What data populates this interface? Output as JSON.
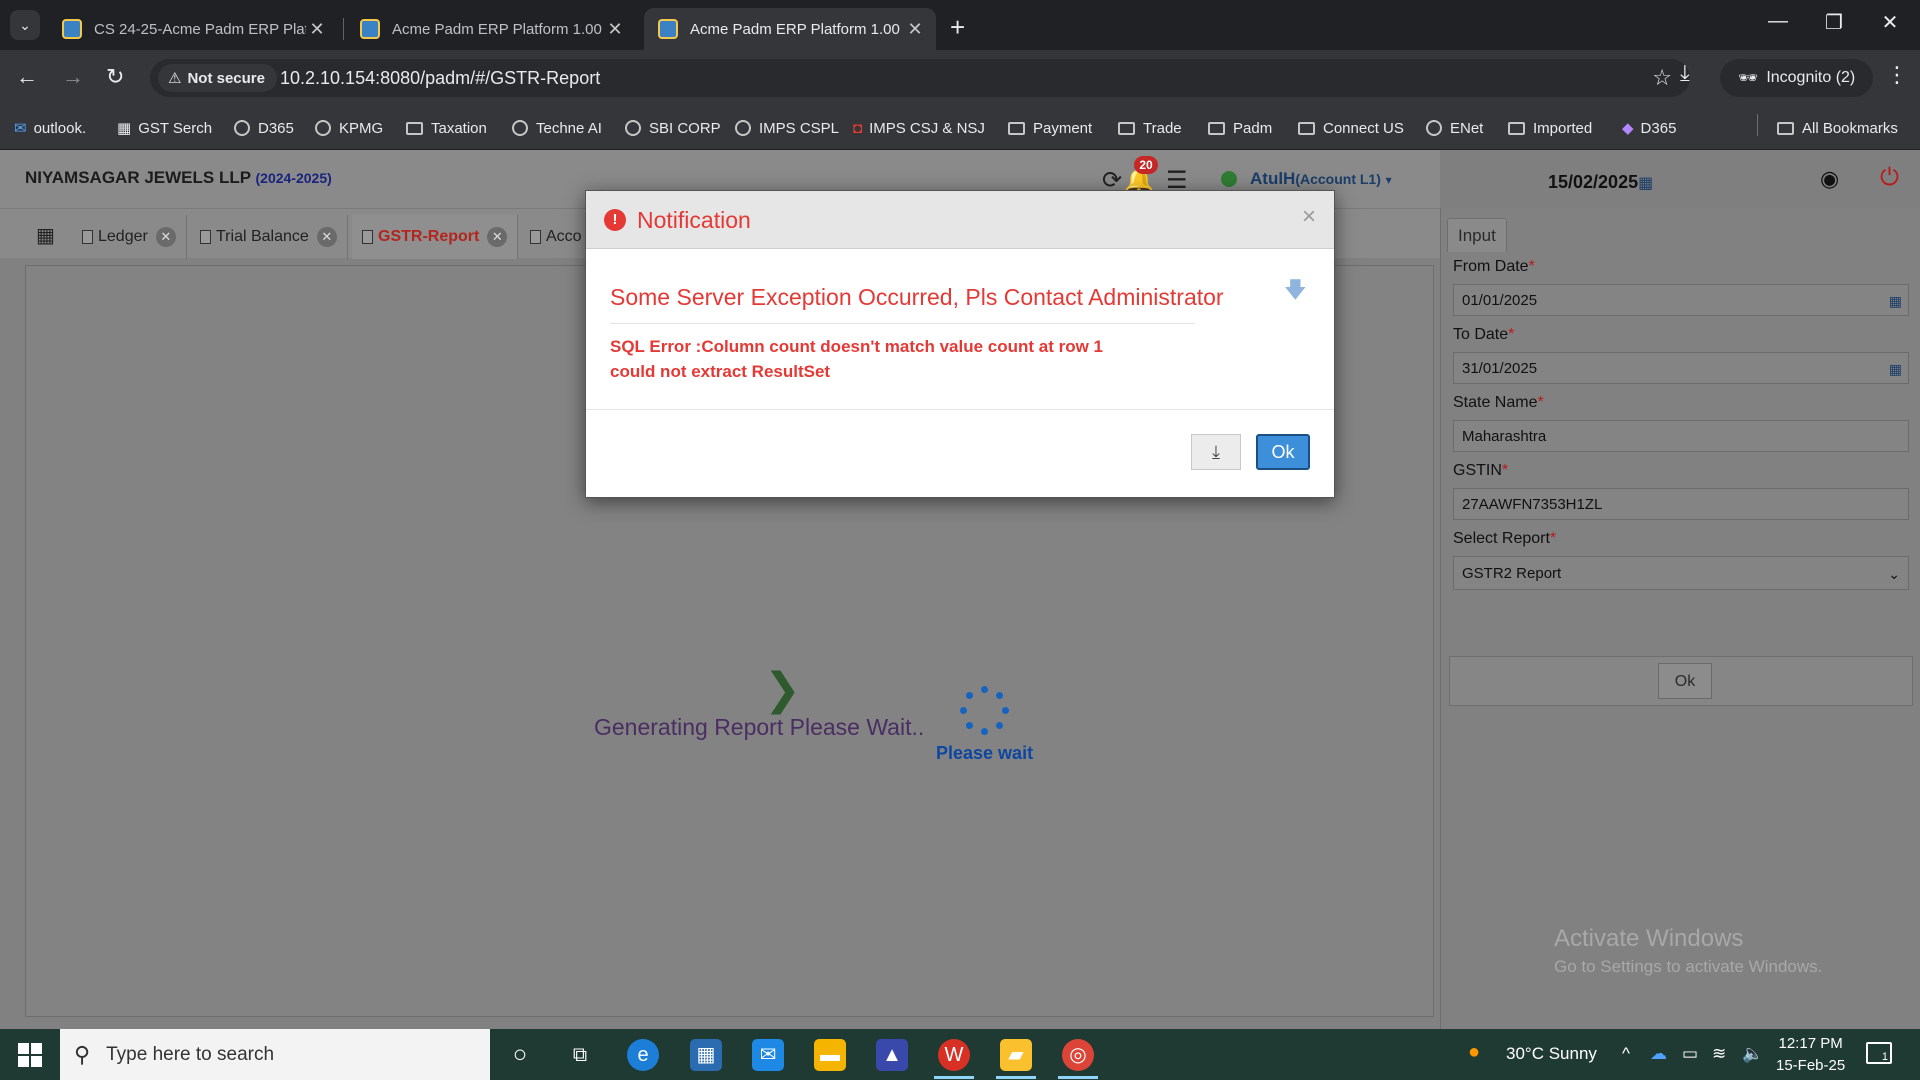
{
  "browser": {
    "tabs": [
      {
        "title": "CS 24-25-Acme Padm ERP Platf",
        "active": false
      },
      {
        "title": "Acme Padm ERP Platform 1.00",
        "active": false
      },
      {
        "title": "Acme Padm ERP Platform 1.00",
        "active": true
      }
    ],
    "not_secure": "Not secure",
    "url": "10.2.10.154:8080/padm/#/GSTR-Report",
    "incognito": "Incognito (2)",
    "bookmarks": [
      "outlook.",
      "GST Serch",
      "D365",
      "KPMG",
      "Taxation",
      "Techne AI",
      "SBI CORP",
      "IMPS CSPL",
      "IMPS CSJ & NSJ",
      "Payment",
      "Trade",
      "Padm",
      "Connect US",
      "ENet",
      "Imported",
      "D365"
    ],
    "all_bookmarks": "All Bookmarks"
  },
  "app": {
    "company": "NIYAMSAGAR JEWELS LLP",
    "year": "(2024-2025)",
    "notif_count": "20",
    "user": "AtulH",
    "role": "(Account L1)",
    "date": "15/02/2025",
    "tabs": [
      "Ledger",
      "Trial Balance",
      "GSTR-Report",
      "Acco"
    ],
    "generating": "Generating Report Please Wait..",
    "please_wait": "Please wait"
  },
  "panel": {
    "tab": "Input",
    "from_date_label": "From Date",
    "from_date": "01/01/2025",
    "to_date_label": "To Date",
    "to_date": "31/01/2025",
    "state_label": "State Name",
    "state": "Maharashtra",
    "gstin_label": "GSTIN",
    "gstin": "27AAWFN7353H1ZL",
    "report_label": "Select Report",
    "report": "GSTR2 Report",
    "ok": "Ok",
    "required": "*"
  },
  "modal": {
    "title": "Notification",
    "close": "×",
    "message": "Some Server Exception Occurred, Pls Contact Administrator",
    "error_line1": "SQL Error :Column count doesn't match value count at row 1",
    "error_line2": "could not extract ResultSet",
    "ok": "Ok"
  },
  "watermark": {
    "line1": "Activate Windows",
    "line2": "Go to Settings to activate Windows."
  },
  "taskbar": {
    "search_placeholder": "Type here to search",
    "weather": "30°C  Sunny",
    "time": "12:17 PM",
    "date": "15-Feb-25",
    "notif_count": "1"
  }
}
